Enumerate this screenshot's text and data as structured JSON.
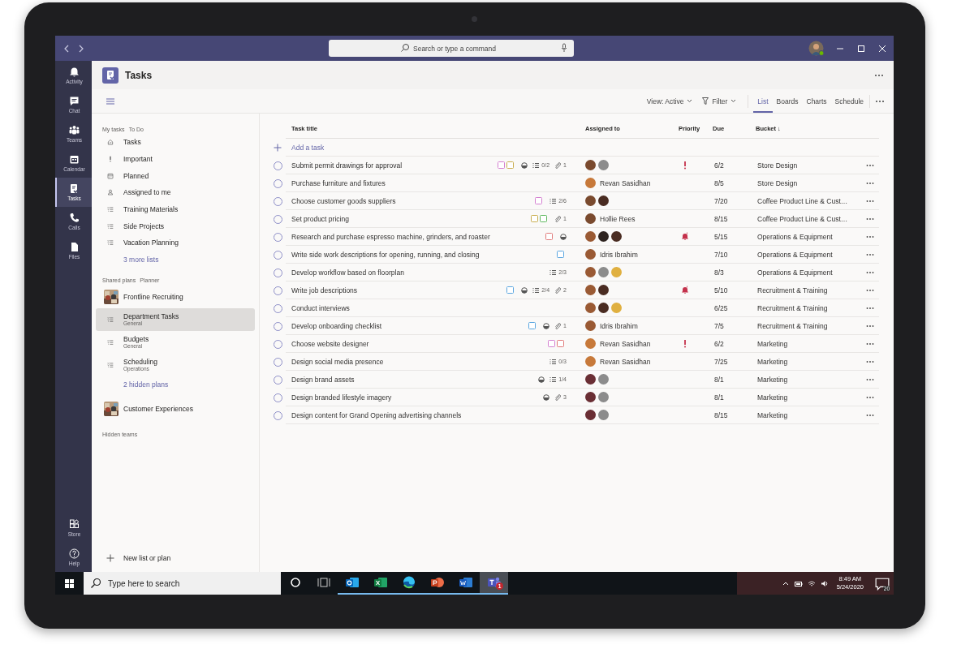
{
  "titlebar": {
    "search": {
      "placeholder": "Search or type a command"
    },
    "profile": {
      "online": true
    }
  },
  "rail": [
    {
      "label": "Activity",
      "kind": "bell",
      "selected": false
    },
    {
      "label": "Chat",
      "kind": "chat",
      "selected": false
    },
    {
      "label": "Teams",
      "kind": "teams",
      "selected": false
    },
    {
      "label": "Calendar",
      "kind": "calendar",
      "selected": false
    },
    {
      "label": "Tasks",
      "kind": "tasks",
      "selected": true
    },
    {
      "label": "Calls",
      "kind": "calls",
      "selected": false
    },
    {
      "label": "Files",
      "kind": "files",
      "selected": false
    }
  ],
  "rail_bottom": [
    {
      "label": "Store",
      "kind": "store"
    },
    {
      "label": "Help",
      "kind": "help"
    }
  ],
  "app": {
    "title": "Tasks"
  },
  "toolbar": {
    "view": "View: Active",
    "filter": "Filter",
    "tabs": [
      {
        "label": "List",
        "selected": true
      },
      {
        "label": "Boards",
        "selected": false
      },
      {
        "label": "Charts",
        "selected": false
      },
      {
        "label": "Schedule",
        "selected": false
      }
    ]
  },
  "sidebar": {
    "my_tasks": {
      "heading": "My tasks",
      "source": "To Do",
      "items": [
        {
          "label": "Tasks",
          "kind": "home"
        },
        {
          "label": "Important",
          "kind": "important"
        },
        {
          "label": "Planned",
          "kind": "planned"
        },
        {
          "label": "Assigned to me",
          "kind": "person"
        },
        {
          "label": "Training Materials",
          "kind": "list"
        },
        {
          "label": "Side Projects",
          "kind": "list"
        },
        {
          "label": "Vacation Planning",
          "kind": "list"
        }
      ],
      "more": "3 more lists"
    },
    "shared_plans": {
      "heading": "Shared plans",
      "source": "Planner",
      "items": [
        {
          "label": "Frontline Recruiting",
          "kind": "team",
          "selected": false
        },
        {
          "label": "Department Tasks",
          "sub": "General",
          "kind": "plan",
          "selected": true
        },
        {
          "label": "Budgets",
          "sub": "General",
          "kind": "plan",
          "selected": false
        },
        {
          "label": "Scheduling",
          "sub": "Operations",
          "kind": "plan",
          "selected": false
        }
      ],
      "more": "2 hidden plans",
      "other_teams": [
        {
          "label": "Customer Experiences",
          "kind": "team",
          "selected": false
        }
      ]
    },
    "hidden": "Hidden teams",
    "new_item": "New list or plan"
  },
  "table": {
    "columns": [
      "Task title",
      "Assigned to",
      "Priority",
      "Due",
      "Bucket ↓"
    ],
    "add_task": "Add a task",
    "rows": [
      {
        "completed": false,
        "title": "Submit permit drawings for approval",
        "labels": [
          {
            "color": "#d47fd0"
          },
          {
            "color": "#c9ad4e"
          }
        ],
        "in_progress": true,
        "checklist": "0/2",
        "attachments": "1",
        "assignees": [
          {
            "color": "#7a4a2e"
          },
          {
            "color": "#8c8c8c"
          }
        ],
        "important": true,
        "urgent": false,
        "due": "6/2",
        "bucket": "Store Design"
      },
      {
        "completed": false,
        "title": "Purchase furniture and fixtures",
        "labels": [],
        "in_progress": false,
        "assignees": [
          {
            "color": "#c7793a"
          }
        ],
        "assignee_name": "Revan Sasidhan",
        "important": false,
        "urgent": false,
        "due": "8/5",
        "bucket": "Store Design"
      },
      {
        "completed": false,
        "title": "Choose customer goods suppliers",
        "labels": [
          {
            "color": "#d47fd0"
          }
        ],
        "in_progress": false,
        "checklist": "2/6",
        "assignees": [
          {
            "color": "#7a4a2e"
          },
          {
            "color": "#4a2c22"
          }
        ],
        "important": false,
        "urgent": false,
        "due": "7/20",
        "bucket": "Coffee Product Line & Cust…"
      },
      {
        "completed": false,
        "title": "Set product pricing",
        "labels": [
          {
            "color": "#c9ad4e"
          },
          {
            "color": "#5fb85f"
          }
        ],
        "in_progress": false,
        "attachments": "1",
        "assignees": [
          {
            "color": "#7a4a2e"
          }
        ],
        "assignee_name": "Hollie Rees",
        "important": false,
        "urgent": false,
        "due": "8/15",
        "bucket": "Coffee Product Line & Cust…"
      },
      {
        "completed": false,
        "title": "Research and purchase espresso machine, grinders, and roaster",
        "labels": [
          {
            "color": "#e07b7b"
          }
        ],
        "in_progress": true,
        "assignees": [
          {
            "color": "#9a5a34"
          },
          {
            "color": "#2e2420"
          },
          {
            "color": "#4a2c22"
          }
        ],
        "important": false,
        "urgent": true,
        "due": "5/15",
        "bucket": "Operations & Equipment"
      },
      {
        "completed": false,
        "title": "Write side work descriptions for opening, running, and closing",
        "labels": [
          {
            "color": "#5aa6e0"
          }
        ],
        "in_progress": false,
        "assignees": [
          {
            "color": "#9a5a34"
          }
        ],
        "assignee_name": "Idris Ibrahim",
        "important": false,
        "urgent": false,
        "due": "7/10",
        "bucket": "Operations & Equipment"
      },
      {
        "completed": false,
        "title": "Develop workflow based on floorplan",
        "labels": [],
        "in_progress": false,
        "checklist": "2/3",
        "assignees": [
          {
            "color": "#9a5a34"
          },
          {
            "color": "#8c8c8c"
          },
          {
            "color": "#e0b040"
          }
        ],
        "important": false,
        "urgent": false,
        "due": "8/3",
        "bucket": "Operations & Equipment"
      },
      {
        "completed": false,
        "title": "Write job descriptions",
        "labels": [
          {
            "color": "#5aa6e0"
          }
        ],
        "in_progress": true,
        "checklist": "2/4",
        "attachments": "2",
        "assignees": [
          {
            "color": "#9a5a34"
          },
          {
            "color": "#4a2c22"
          }
        ],
        "important": false,
        "urgent": true,
        "due": "5/10",
        "bucket": "Recruitment & Training"
      },
      {
        "completed": false,
        "title": "Conduct interviews",
        "labels": [],
        "in_progress": false,
        "assignees": [
          {
            "color": "#9a5a34"
          },
          {
            "color": "#4a2c22"
          },
          {
            "color": "#e0b040"
          }
        ],
        "important": false,
        "urgent": false,
        "due": "6/25",
        "bucket": "Recruitment & Training"
      },
      {
        "completed": false,
        "title": "Develop onboarding checklist",
        "labels": [
          {
            "color": "#5aa6e0"
          }
        ],
        "in_progress": true,
        "attachments": "1",
        "assignees": [
          {
            "color": "#9a5a34"
          }
        ],
        "assignee_name": "Idris Ibrahim",
        "important": false,
        "urgent": false,
        "due": "7/5",
        "bucket": "Recruitment & Training"
      },
      {
        "completed": false,
        "title": "Choose website designer",
        "labels": [
          {
            "color": "#d47fd0"
          },
          {
            "color": "#e07b7b"
          }
        ],
        "in_progress": false,
        "assignees": [
          {
            "color": "#c7793a"
          }
        ],
        "assignee_name": "Revan Sasidhan",
        "important": true,
        "urgent": false,
        "due": "6/2",
        "bucket": "Marketing"
      },
      {
        "completed": false,
        "title": "Design social media presence",
        "labels": [],
        "in_progress": false,
        "checklist": "0/3",
        "assignees": [
          {
            "color": "#c7793a"
          }
        ],
        "assignee_name": "Revan Sasidhan",
        "important": false,
        "urgent": false,
        "due": "7/25",
        "bucket": "Marketing"
      },
      {
        "completed": false,
        "title": "Design brand assets",
        "labels": [],
        "in_progress": true,
        "checklist": "1/4",
        "assignees": [
          {
            "color": "#6a2e34"
          },
          {
            "color": "#8c8c8c"
          }
        ],
        "important": false,
        "urgent": false,
        "due": "8/1",
        "bucket": "Marketing"
      },
      {
        "completed": false,
        "title": "Design branded lifestyle imagery",
        "labels": [],
        "in_progress": true,
        "attachments": "3",
        "assignees": [
          {
            "color": "#6a2e34"
          },
          {
            "color": "#8c8c8c"
          }
        ],
        "important": false,
        "urgent": false,
        "due": "8/1",
        "bucket": "Marketing"
      },
      {
        "completed": false,
        "title": "Design content for Grand Opening advertising channels",
        "labels": [],
        "in_progress": false,
        "assignees": [
          {
            "color": "#6a2e34"
          },
          {
            "color": "#8c8c8c"
          }
        ],
        "important": false,
        "urgent": false,
        "due": "8/15",
        "bucket": "Marketing"
      }
    ]
  },
  "taskbar": {
    "search": {
      "placeholder": "Type here to search"
    },
    "apps": [
      {
        "kind": "cortana",
        "running": false,
        "active": false
      },
      {
        "kind": "taskview",
        "running": false,
        "active": false
      },
      {
        "kind": "outlook",
        "running": true,
        "active": false
      },
      {
        "kind": "excel",
        "running": true,
        "active": false
      },
      {
        "kind": "edge",
        "running": true,
        "active": false
      },
      {
        "kind": "powerpoint",
        "running": true,
        "active": false
      },
      {
        "kind": "word",
        "running": true,
        "active": false
      },
      {
        "kind": "teams",
        "running": true,
        "active": true,
        "badge": "1"
      }
    ],
    "time": "8:49 AM",
    "date": "5/24/2020",
    "notifications": "20"
  }
}
